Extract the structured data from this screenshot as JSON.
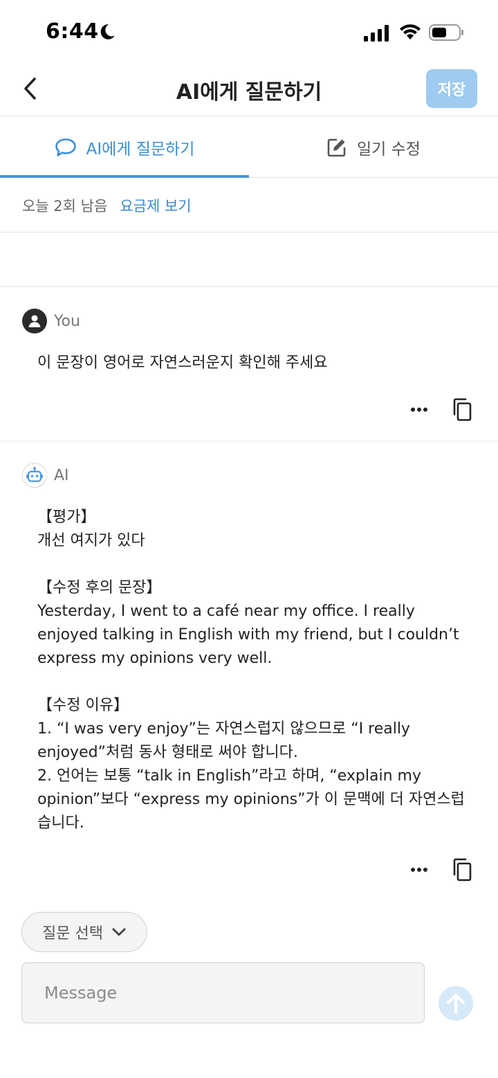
{
  "status_bar": {
    "time": "6:44"
  },
  "header": {
    "title": "AI에게 질문하기",
    "save_label": "저장"
  },
  "tabs": [
    {
      "label": "AI에게 질문하기",
      "active": true
    },
    {
      "label": "일기 수정",
      "active": false
    }
  ],
  "quota": {
    "remaining": "오늘 2회 남음",
    "plan_link": "요금제 보기"
  },
  "messages": [
    {
      "sender": "You",
      "text": "이 문장이 영어로 자연스러운지 확인해 주세요"
    },
    {
      "sender": "AI",
      "text": "【평가】\n개선 여지가 있다\n\n【수정 후의 문장】\nYesterday, I went to a café near my office. I really enjoyed talking in English with my friend, but I couldn’t express my opinions very well.\n\n【수정 이유】\n1. “I was very enjoy”는 자연스럽지 않으므로 “I really enjoyed”처럼 동사 형태로 써야 합니다.\n2. 언어는 보통 “talk in English”라고 하며, “explain my opinion”보다 “express my opinions”가 이 문맥에 더 자연스럽습니다."
    }
  ],
  "composer": {
    "question_select_label": "질문 선택",
    "placeholder": "Message",
    "value": ""
  },
  "colors": {
    "accent": "#3a8fd6",
    "save_button": "#9ecbef",
    "send_button": "#d6e9f8"
  }
}
